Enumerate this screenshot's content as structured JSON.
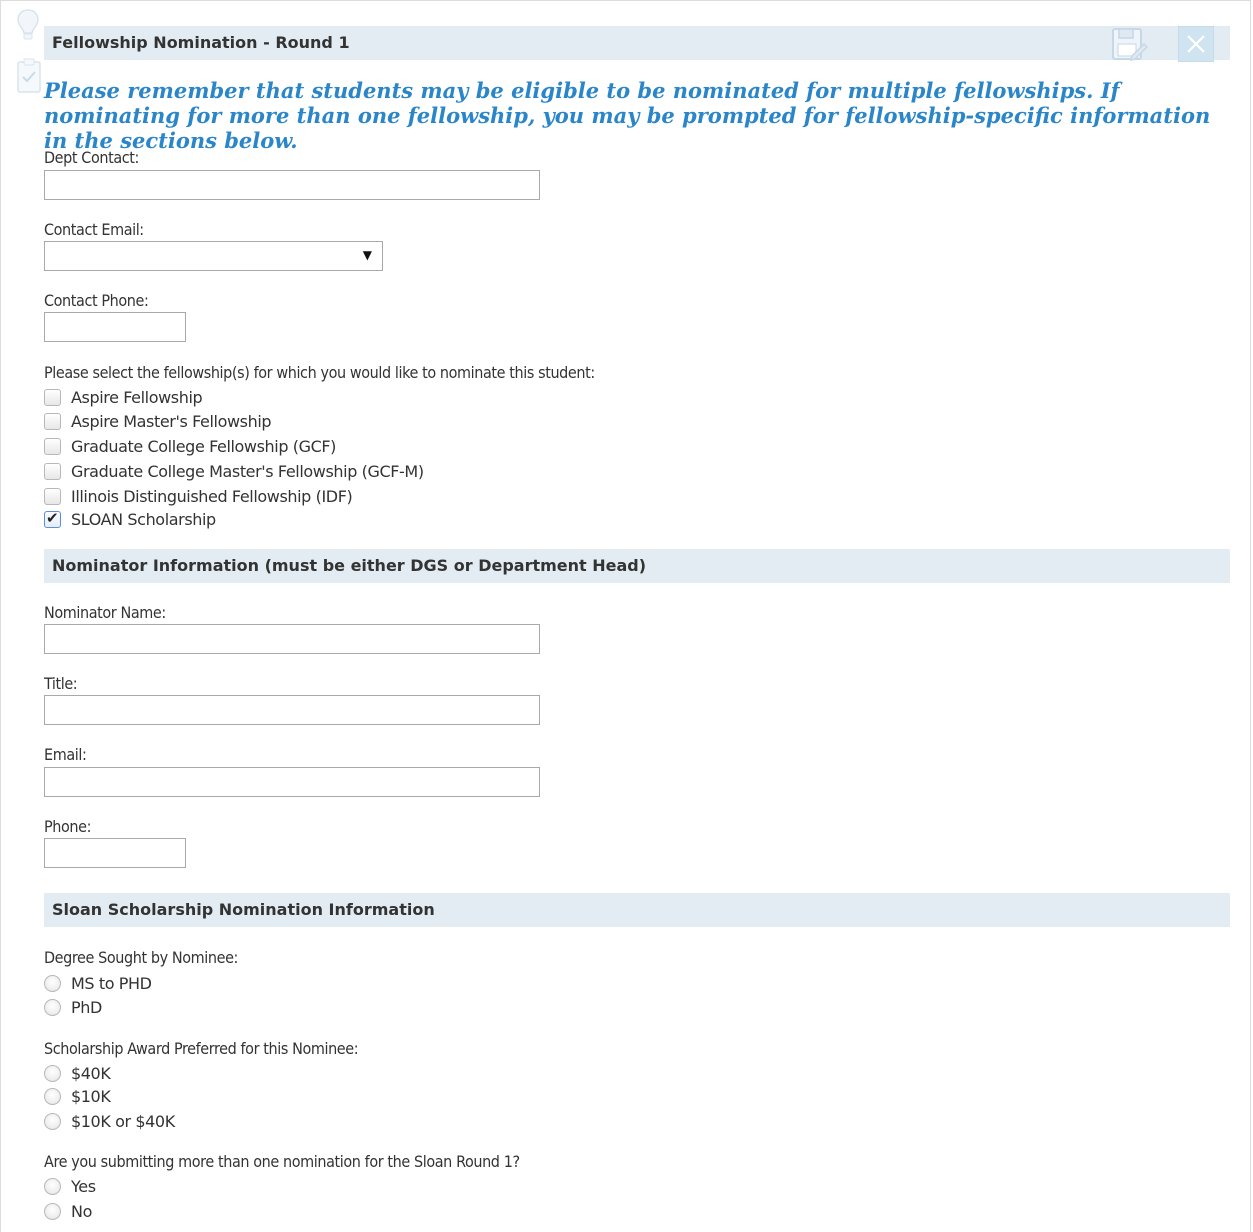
{
  "section_form": {
    "title": "Fellowship Nomination - Round 1"
  },
  "toolbar": {
    "save_icon": "save-icon",
    "close_icon": "close-icon"
  },
  "notice": "Please remember that students may be eligible to be nominated for multiple fellowships. If nominating for more than one fellowship, you may be prompted for fellowship-specific information in the sections below.",
  "dept_contact": {
    "label": "Dept Contact:",
    "value": ""
  },
  "contact_email": {
    "label": "Contact Email:",
    "selected": ""
  },
  "contact_phone": {
    "label": "Contact Phone:",
    "value": ""
  },
  "fellowships": {
    "prompt": "Please select the fellowship(s) for which you would like to nominate this student:",
    "options": [
      {
        "label": "Aspire Fellowship",
        "checked": false
      },
      {
        "label": "Aspire Master's Fellowship",
        "checked": false
      },
      {
        "label": "Graduate College Fellowship (GCF)",
        "checked": false
      },
      {
        "label": "Graduate College Master's Fellowship (GCF-M)",
        "checked": false
      },
      {
        "label": "Illinois Distinguished Fellowship (IDF)",
        "checked": false
      },
      {
        "label": "SLOAN Scholarship",
        "checked": true
      }
    ]
  },
  "nominator": {
    "title": "Nominator Information (must be either DGS or Department Head)",
    "name_label": "Nominator Name:",
    "title_label": "Title:",
    "email_label": "Email:",
    "phone_label": "Phone:"
  },
  "sloan": {
    "title": "Sloan Scholarship Nomination Information",
    "degree": {
      "label": "Degree Sought by Nominee:",
      "options": [
        "MS to PHD",
        "PhD"
      ]
    },
    "award": {
      "label": "Scholarship Award Preferred for this Nominee:",
      "options": [
        "$40K",
        "$10K",
        "$10K or $40K"
      ]
    },
    "multiple": {
      "label": "Are you submitting more than one nomination for the Sloan Round 1?",
      "options": [
        "Yes",
        "No"
      ]
    }
  },
  "colors": {
    "header_bg": "#e3ecf2",
    "notice_text": "#2a86c8",
    "close_bg": "#cfe3f1"
  }
}
